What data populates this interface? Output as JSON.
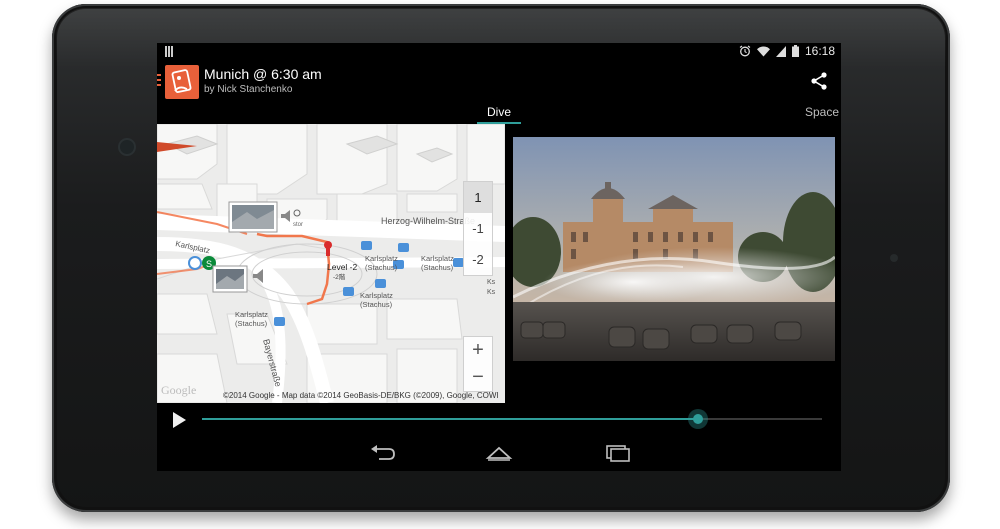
{
  "status_bar": {
    "time": "16:18",
    "icons": [
      "notification-icon",
      "alarm-icon",
      "wifi-icon",
      "signal-icon",
      "battery-icon"
    ]
  },
  "action_bar": {
    "title": "Munich @ 6:30 am",
    "subtitle": "by Nick Stanchenko",
    "actions": [
      "share-icon"
    ]
  },
  "tabs": [
    {
      "label": "Dive",
      "selected": true
    },
    {
      "label": "Space",
      "selected": false
    }
  ],
  "map": {
    "labels": {
      "herzog": "Herzog-Wilhelm-Straße",
      "karlsplatz_top": "Karlsplatz",
      "karlsplatz_stachus_1": "Karlsplatz",
      "stachus_1": "(Stachus)",
      "karlsplatz_stachus_2": "Karlsplatz",
      "stachus_2": "(Stachus)",
      "karlsplatz_stachus_3": "Karlsplatz",
      "stachus_3": "(Stachus)",
      "karlsplatz_bottom": "Karlsplatz",
      "stachus_bottom": "(Stachus)",
      "bayerstrasse": "Bayerstraße",
      "level_marker": "Level -2",
      "level_sub": "-2階",
      "stor": "stor",
      "ks": "Ks",
      "ks2": "Ks"
    },
    "level_buttons": [
      "1",
      "-1",
      "-2"
    ],
    "active_level": "1",
    "zoom_in": "+",
    "zoom_out": "−",
    "attribution": "©2014 Google - Map data ©2014 GeoBasis-DE/BKG (©2009), Google, COWI",
    "logo": "Google"
  },
  "player": {
    "progress": 0.8,
    "play_icon": "play-icon"
  },
  "navbar": {
    "buttons": [
      "back-icon",
      "home-icon",
      "recents-icon"
    ]
  },
  "colors": {
    "accent": "#2f9e9a",
    "brand": "#e8603a",
    "route": "#f26a3b"
  }
}
